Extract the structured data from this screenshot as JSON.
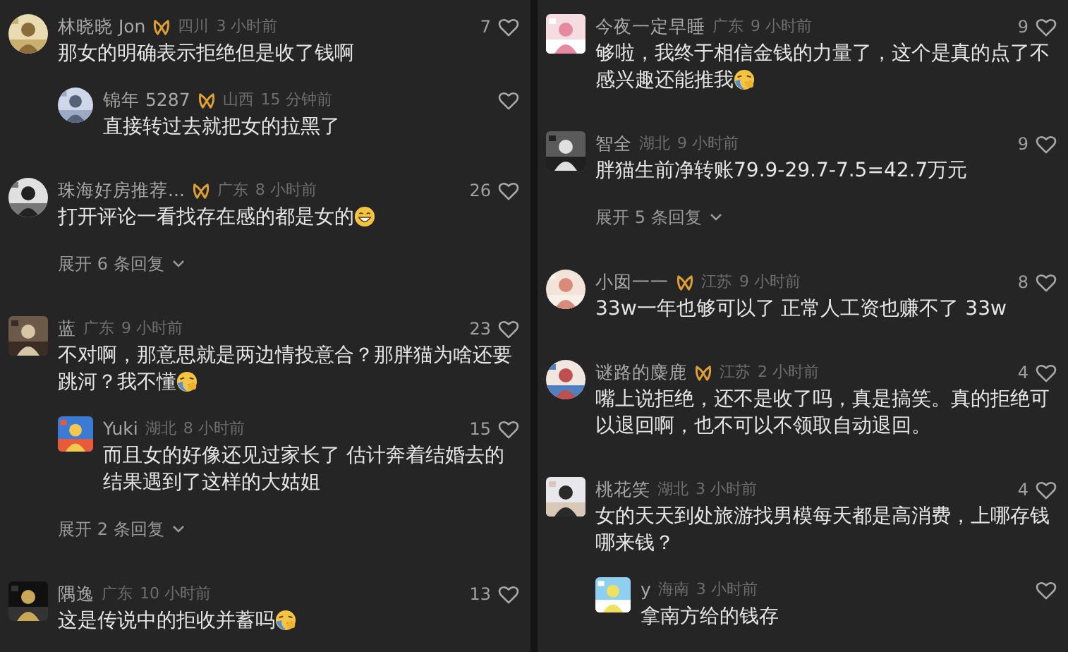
{
  "columns": [
    {
      "comments": [
        {
          "name": "林晓晓 Jon",
          "badge": true,
          "avatar": {
            "kind": "round"
          },
          "region": "四川",
          "time": "3 小时前",
          "likes": "7",
          "text": "那女的明确表示拒绝但是收了钱啊",
          "replies": [
            {
              "name": "锦年 5287",
              "badge": true,
              "avatar": {
                "kind": "round"
              },
              "region": "山西",
              "time": "15 分钟前",
              "text": "直接转过去就把女的拉黑了"
            }
          ]
        },
        {
          "name": "珠海好房推荐...",
          "badge": true,
          "avatar": {
            "kind": "round"
          },
          "region": "广东",
          "time": "8 小时前",
          "likes": "26",
          "text": "打开评论一看找存在感的都是女的",
          "emoji": {
            "kind": "grin"
          },
          "expand": "展开 6 条回复"
        },
        {
          "name": "蓝",
          "badge": false,
          "avatar": {
            "kind": "square"
          },
          "region": "广东",
          "time": "9 小时前",
          "likes": "23",
          "text": "不对啊，那意思就是两边情投意合？那胖猫为啥还要跳河？我不懂",
          "emoji": {
            "kind": "cry"
          },
          "replies": [
            {
              "name": "Yuki",
              "badge": false,
              "avatar": {
                "kind": "square"
              },
              "region": "湖北",
              "time": "8 小时前",
              "likes": "15",
              "text": "而且女的好像还见过家长了 估计奔着结婚去的结果遇到了这样的大姑姐"
            }
          ],
          "expand": "展开 2 条回复"
        },
        {
          "name": "隅逸",
          "badge": false,
          "avatar": {
            "kind": "square"
          },
          "region": "广东",
          "time": "10 小时前",
          "likes": "13",
          "text": "这是传说中的拒收并蓄吗",
          "emoji": {
            "kind": "cry"
          }
        }
      ]
    },
    {
      "comments": [
        {
          "name": "今夜一定早睡",
          "badge": false,
          "avatar": {
            "kind": "square"
          },
          "region": "广东",
          "time": "9 小时前",
          "likes": "9",
          "text": "够啦，我终于相信金钱的力量了，这个是真的点了不感兴趣还能推我",
          "emoji": {
            "kind": "cry"
          }
        },
        {
          "name": "智全",
          "badge": false,
          "avatar": {
            "kind": "square"
          },
          "region": "湖北",
          "time": "9 小时前",
          "likes": "9",
          "text": "胖猫生前净转账79.9-29.7-7.5=42.7万元",
          "expand": "展开 5 条回复"
        },
        {
          "name": "小囡一一",
          "badge": true,
          "avatar": {
            "kind": "round"
          },
          "region": "江苏",
          "time": "9 小时前",
          "likes": "8",
          "text": "33w一年也够可以了 正常人工资也赚不了 33w"
        },
        {
          "name": "谜路的麋鹿",
          "badge": true,
          "avatar": {
            "kind": "round"
          },
          "region": "江苏",
          "time": "2 小时前",
          "likes": "4",
          "text": "嘴上说拒绝，还不是收了吗，真是搞笑。真的拒绝可以退回啊，也不可以不领取自动退回。"
        },
        {
          "name": "桃花笑",
          "badge": false,
          "avatar": {
            "kind": "square"
          },
          "region": "湖北",
          "time": "3 小时前",
          "likes": "4",
          "text": "女的天天到处旅游找男模每天都是高消费，上哪存钱哪来钱？",
          "replies": [
            {
              "name": "y",
              "badge": false,
              "avatar": {
                "kind": "square"
              },
              "region": "海南",
              "time": "3 小时前",
              "text": "拿南方给的钱存"
            }
          ]
        }
      ]
    }
  ]
}
